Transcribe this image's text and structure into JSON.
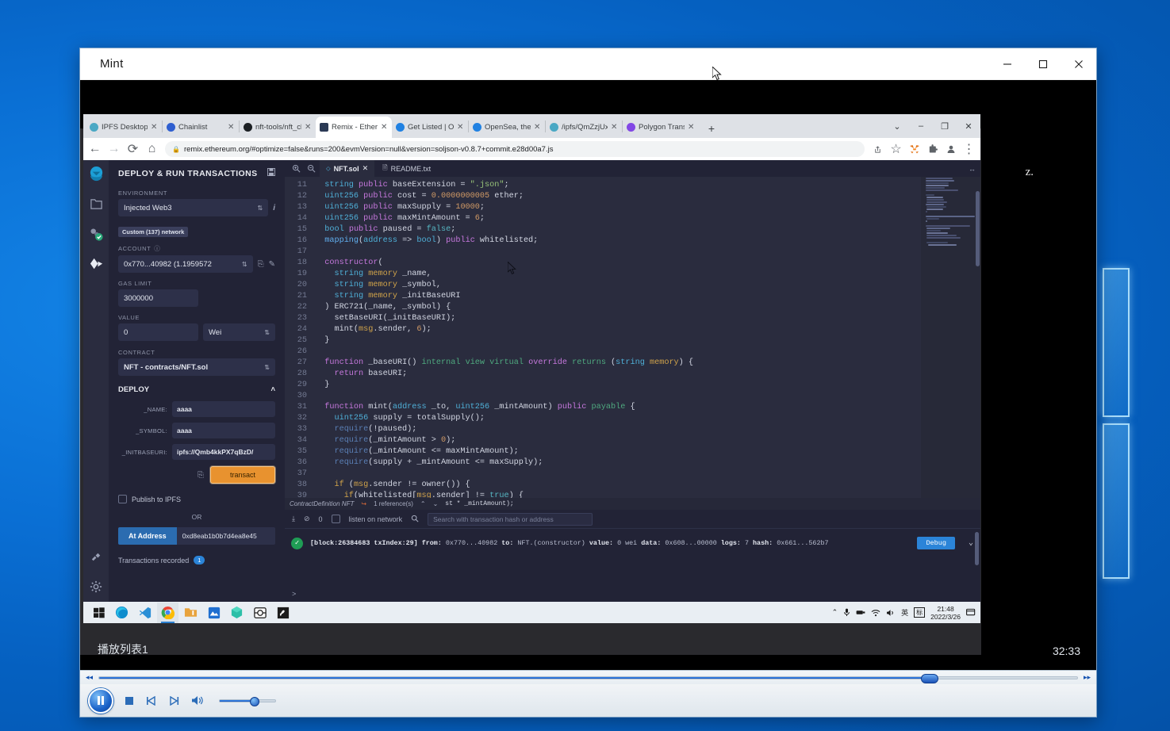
{
  "desktop": {
    "wallpaper_color": "#0a6fd4"
  },
  "player_window": {
    "title": "Mint",
    "controls": {
      "minimize": "—",
      "maximize": "☐",
      "close": "✕"
    },
    "playlist_label": "播放列表1",
    "duration": "32:33",
    "video_watermark": "z.",
    "transport": {
      "play_pause": "pause-button",
      "stop": "stop-button",
      "previous": "previous-button",
      "next": "next-button",
      "mute": "volume-button",
      "rewind": "◂◂",
      "fast_forward": "▸▸",
      "seek_percent": 85,
      "volume_percent": 60
    }
  },
  "browser": {
    "tabs": [
      {
        "label": "IPFS Desktop | I",
        "favicon": "#4aa8c4",
        "active": false
      },
      {
        "label": "Chainlist",
        "favicon": "#2f5fd0",
        "active": false
      },
      {
        "label": "nft-tools/nft_cl",
        "favicon": "#1b1f23",
        "active": false
      },
      {
        "label": "Remix - Ethereu",
        "favicon": "#2b3a55",
        "active": true
      },
      {
        "label": "Get Listed | Ope",
        "favicon": "#2081e2",
        "active": false
      },
      {
        "label": "OpenSea, the la",
        "favicon": "#2081e2",
        "active": false
      },
      {
        "label": "/ipfs/QmZzjUxG",
        "favicon": "#4aa8c4",
        "active": false
      },
      {
        "label": "Polygon Transa",
        "favicon": "#8247e5",
        "active": false
      }
    ],
    "new_tab_label": "+",
    "window_controls": {
      "tab_search": "⌄",
      "minimize": "–",
      "maximize": "❐",
      "close": "✕"
    },
    "toolbar": {
      "back": "←",
      "forward": "→",
      "reload": "⟳",
      "home": "⌂",
      "lock": "🔒",
      "url": "remix.ethereum.org/#optimize=false&runs=200&evmVersion=null&version=soljson-v0.8.7+commit.e28d00a7.js",
      "share": "share-icon",
      "bookmark": "☆",
      "extension_metamask": "metamask-icon",
      "extension_puzzle": "extensions-icon",
      "profile": "profile-icon",
      "menu": "⋮"
    }
  },
  "remix": {
    "icon_bar": [
      "remix-logo",
      "file-explorer-icon",
      "solidity-compiler-icon",
      "deploy-run-icon",
      "plugin-manager-icon",
      "settings-icon"
    ],
    "panel": {
      "title": "DEPLOY & RUN TRANSACTIONS",
      "save_icon": "save-icon",
      "environment_label": "ENVIRONMENT",
      "environment_value": "Injected Web3",
      "environment_info": "i",
      "network_badge": "Custom (137) network",
      "account_label": "ACCOUNT",
      "account_value": "0x770...40982 (1.1959572",
      "gas_limit_label": "GAS LIMIT",
      "gas_limit_value": "3000000",
      "value_label": "VALUE",
      "value_amount": "0",
      "value_unit": "Wei",
      "contract_label": "CONTRACT",
      "contract_value": "NFT - contracts/NFT.sol",
      "deploy_label": "DEPLOY",
      "deploy_collapse": "˄",
      "params": [
        {
          "label": "_NAME:",
          "value": "aaaa"
        },
        {
          "label": "_SYMBOL:",
          "value": "aaaa"
        },
        {
          "label": "_INITBASEURI:",
          "value": "ipfs://Qmb4kkPX7qBzD/"
        }
      ],
      "copy_icon": "copy-icon",
      "transact_label": "transact",
      "publish_ipfs_label": "Publish to IPFS",
      "or_label": "OR",
      "at_address_label": "At Address",
      "at_address_value": "0xd8eab1b0b7d4ea8e45",
      "transactions_recorded_label": "Transactions recorded",
      "transactions_recorded_count": "1"
    },
    "editor": {
      "zoom_in": "zoom-in-icon",
      "zoom_out": "zoom-out-icon",
      "tabs": [
        {
          "label": "NFT.sol",
          "active": true,
          "close": "✕"
        },
        {
          "label": "README.txt",
          "active": false
        }
      ],
      "expand_icon": "↔",
      "lines": [
        {
          "n": 11,
          "html": "  <span class=\"typ\">string</span> <span class=\"kw\">public</span> baseExtension = <span class=\"str\">\".json\"</span>;"
        },
        {
          "n": 12,
          "html": "  <span class=\"typ\">uint256</span> <span class=\"kw\">public</span> cost = <span class=\"num\">0.0000000005</span> ether;"
        },
        {
          "n": 13,
          "html": "  <span class=\"typ\">uint256</span> <span class=\"kw\">public</span> maxSupply = <span class=\"num\">10000</span>;"
        },
        {
          "n": 14,
          "html": "  <span class=\"typ\">uint256</span> <span class=\"kw\">public</span> maxMintAmount = <span class=\"num\">6</span>;"
        },
        {
          "n": 15,
          "html": "  <span class=\"typ\">bool</span> <span class=\"kw\">public</span> paused = <span class=\"bool\">false</span>;"
        },
        {
          "n": 16,
          "html": "  <span class=\"fn\">mapping</span>(<span class=\"typ\">address</span> =&gt; <span class=\"typ\">bool</span>) <span class=\"kw\">public</span> whitelisted;"
        },
        {
          "n": 17,
          "html": ""
        },
        {
          "n": 18,
          "html": "  <span class=\"kw\">constructor</span>("
        },
        {
          "n": 19,
          "html": "    <span class=\"typ\">string</span> <span class=\"mem\">memory</span> _name,"
        },
        {
          "n": 20,
          "html": "    <span class=\"typ\">string</span> <span class=\"mem\">memory</span> _symbol,"
        },
        {
          "n": 21,
          "html": "    <span class=\"typ\">string</span> <span class=\"mem\">memory</span> _initBaseURI"
        },
        {
          "n": 22,
          "html": "  ) ERC721(_name, _symbol) {"
        },
        {
          "n": 23,
          "html": "    setBaseURI(_initBaseURI);"
        },
        {
          "n": 24,
          "html": "    mint(<span class=\"mem\">msg</span>.sender, <span class=\"num\">6</span>);"
        },
        {
          "n": 25,
          "html": "  }"
        },
        {
          "n": 26,
          "html": ""
        },
        {
          "n": 27,
          "html": "  <span class=\"kw\">function</span> _baseURI() <span class=\"grn\">internal</span> <span class=\"grn\">view</span> <span class=\"grn\">virtual</span> <span class=\"kw\">override</span> <span class=\"grn\">returns</span> (<span class=\"typ\">string</span> <span class=\"mem\">memory</span>) {"
        },
        {
          "n": 28,
          "html": "    <span class=\"kw\">return</span> baseURI;"
        },
        {
          "n": 29,
          "html": "  }"
        },
        {
          "n": 30,
          "html": ""
        },
        {
          "n": 31,
          "html": "  <span class=\"kw\">function</span> mint(<span class=\"typ\">address</span> _to, <span class=\"typ\">uint256</span> _mintAmount) <span class=\"kw\">public</span> <span class=\"grn\">payable</span> {"
        },
        {
          "n": 32,
          "html": "    <span class=\"typ\">uint256</span> supply = totalSupply();"
        },
        {
          "n": 33,
          "html": "    <span class=\"req\">require</span>(!paused);"
        },
        {
          "n": 34,
          "html": "    <span class=\"req\">require</span>(_mintAmount &gt; <span class=\"num\">0</span>);"
        },
        {
          "n": 35,
          "html": "    <span class=\"req\">require</span>(_mintAmount &lt;= maxMintAmount);"
        },
        {
          "n": 36,
          "html": "    <span class=\"req\">require</span>(supply + _mintAmount &lt;= maxSupply);"
        },
        {
          "n": 37,
          "html": ""
        },
        {
          "n": 38,
          "html": "    <span class=\"mem\">if</span> (<span class=\"mem\">msg</span>.sender != owner()) {"
        },
        {
          "n": 39,
          "html": "      <span class=\"mem\">if</span>(whitelisted[<span class=\"mem\">msg</span>.sender] != <span class=\"bool\">true</span>) {"
        }
      ],
      "status": {
        "definition": "ContractDefinition NFT",
        "goto_icon": "↪",
        "references": "1 reference(s)",
        "up": "⌃",
        "down": "⌄",
        "trailing": "st * _mintAmount);"
      }
    },
    "terminal": {
      "collapse_icon": "⤓",
      "clear_icon": "⊘",
      "pending_count": "0",
      "listen_label": "listen on network",
      "search_icon": "search-icon",
      "search_placeholder": "Search with transaction hash or address",
      "log": {
        "status": "success",
        "block": "[block:26384683 txIndex:29]",
        "from_label": "from:",
        "from": "0x770...40982",
        "to_label": "to:",
        "to": "NFT.(constructor)",
        "value_label": "value:",
        "value": "0 wei",
        "data_label": "data:",
        "data": "0x608...00000",
        "logs_label": "logs:",
        "logs": "7",
        "hash_label": "hash:",
        "hash": "0x661...562b7",
        "debug_label": "Debug",
        "expand": "⌄"
      }
    }
  },
  "taskbar": {
    "start": "windows-start-icon",
    "apps": [
      "edge-icon",
      "vscode-icon",
      "chrome-icon",
      "folder-icon",
      "app-blue-icon",
      "ipfs-icon",
      "snipping-icon",
      "acrobat-icon"
    ],
    "tray": {
      "overflow": "⌃",
      "mic": "mic-icon",
      "usb": "usb-icon",
      "wifi": "wifi-icon",
      "volume": "volume-icon",
      "ime": "英",
      "ime2": "标",
      "time": "21:48",
      "date": "2022/3/26",
      "notifications": "notification-icon"
    }
  }
}
